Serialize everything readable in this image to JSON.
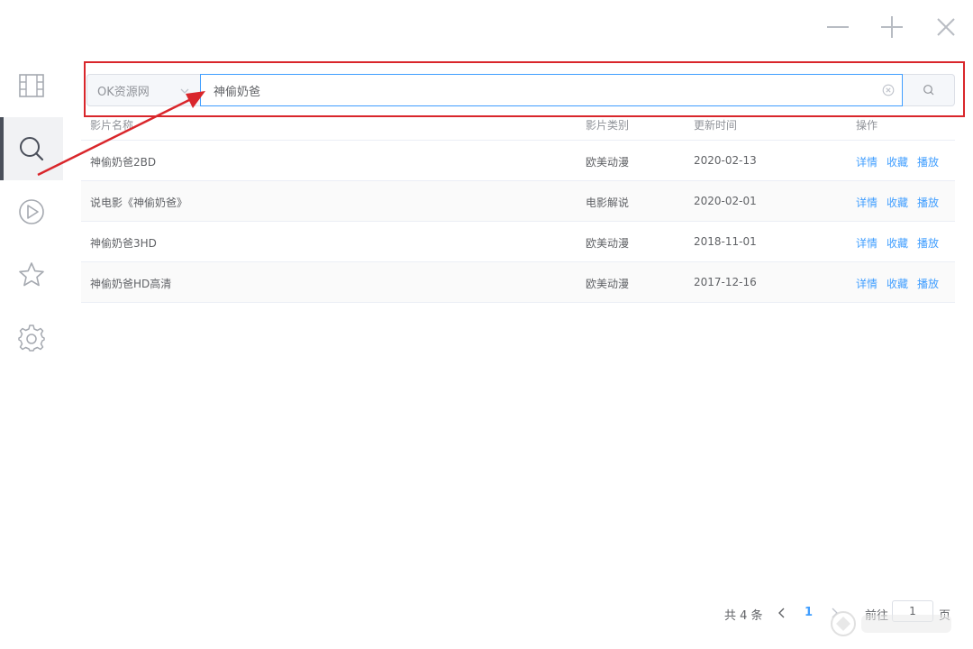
{
  "window": {
    "controls": [
      "minimize",
      "maximize",
      "close"
    ]
  },
  "sidebar": {
    "items": [
      {
        "icon": "film-grid-icon",
        "active": false
      },
      {
        "icon": "search-icon",
        "active": true
      },
      {
        "icon": "play-icon",
        "active": false
      },
      {
        "icon": "star-icon",
        "active": false
      },
      {
        "icon": "gear-icon",
        "active": false
      }
    ]
  },
  "search": {
    "source_label": "OK资源网",
    "query": "神偷奶爸"
  },
  "table": {
    "headers": {
      "name": "影片名称",
      "type": "影片类别",
      "date": "更新时间",
      "ops": "操作"
    },
    "rows": [
      {
        "name": "神偷奶爸2BD",
        "type": "欧美动漫",
        "date": "2020-02-13"
      },
      {
        "name": "说电影《神偷奶爸》",
        "type": "电影解说",
        "date": "2020-02-01"
      },
      {
        "name": "神偷奶爸3HD",
        "type": "欧美动漫",
        "date": "2018-11-01"
      },
      {
        "name": "神偷奶爸HD高清",
        "type": "欧美动漫",
        "date": "2017-12-16"
      }
    ],
    "ops": {
      "detail": "详情",
      "favorite": "收藏",
      "play": "播放"
    }
  },
  "pagination": {
    "total": "共 4 条",
    "current_page": "1",
    "goto_label": "前往",
    "goto_value": "1",
    "page_unit": "页"
  },
  "colors": {
    "accent": "#409eff",
    "annotation": "#d9262b",
    "sidebar_active_bar": "#4a4f5a"
  }
}
